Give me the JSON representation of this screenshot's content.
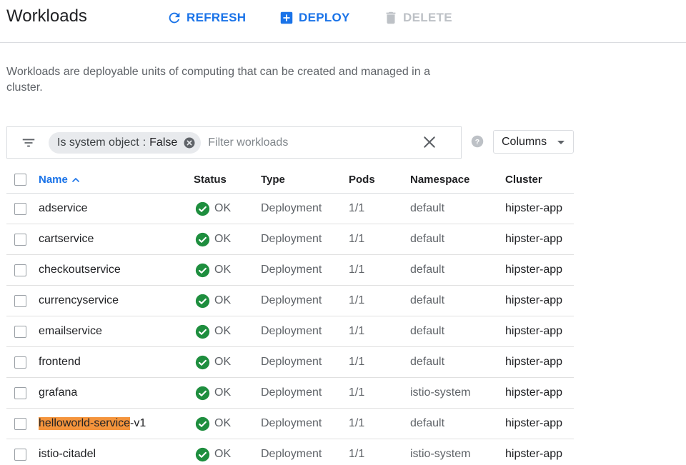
{
  "header": {
    "title": "Workloads",
    "refresh_label": "REFRESH",
    "deploy_label": "DEPLOY",
    "delete_label": "DELETE"
  },
  "description": "Workloads are deployable units of computing that can be created and managed in a cluster.",
  "filter": {
    "chip_key": "Is system object",
    "chip_sep": ":",
    "chip_value": "False",
    "placeholder": "Filter workloads"
  },
  "columns_button": "Columns",
  "table": {
    "headers": {
      "name": "Name",
      "status": "Status",
      "type": "Type",
      "pods": "Pods",
      "namespace": "Namespace",
      "cluster": "Cluster"
    },
    "rows": [
      {
        "name": "adservice",
        "name_hl": "",
        "status": "OK",
        "type": "Deployment",
        "pods": "1/1",
        "namespace": "default",
        "cluster": "hipster-app"
      },
      {
        "name": "cartservice",
        "name_hl": "",
        "status": "OK",
        "type": "Deployment",
        "pods": "1/1",
        "namespace": "default",
        "cluster": "hipster-app"
      },
      {
        "name": "checkoutservice",
        "name_hl": "",
        "status": "OK",
        "type": "Deployment",
        "pods": "1/1",
        "namespace": "default",
        "cluster": "hipster-app"
      },
      {
        "name": "currencyservice",
        "name_hl": "",
        "status": "OK",
        "type": "Deployment",
        "pods": "1/1",
        "namespace": "default",
        "cluster": "hipster-app"
      },
      {
        "name": "emailservice",
        "name_hl": "",
        "status": "OK",
        "type": "Deployment",
        "pods": "1/1",
        "namespace": "default",
        "cluster": "hipster-app"
      },
      {
        "name": "frontend",
        "name_hl": "",
        "status": "OK",
        "type": "Deployment",
        "pods": "1/1",
        "namespace": "default",
        "cluster": "hipster-app"
      },
      {
        "name": "grafana",
        "name_hl": "",
        "status": "OK",
        "type": "Deployment",
        "pods": "1/1",
        "namespace": "istio-system",
        "cluster": "hipster-app"
      },
      {
        "name": "-v1",
        "name_hl": "helloworld-service",
        "status": "OK",
        "type": "Deployment",
        "pods": "1/1",
        "namespace": "default",
        "cluster": "hipster-app"
      },
      {
        "name": "istio-citadel",
        "name_hl": "",
        "status": "OK",
        "type": "Deployment",
        "pods": "1/1",
        "namespace": "istio-system",
        "cluster": "hipster-app"
      }
    ]
  },
  "colors": {
    "accent": "#1a73e8",
    "ok_green": "#1e8e3e",
    "highlight": "#f4943c",
    "disabled": "#bdc1c6"
  }
}
